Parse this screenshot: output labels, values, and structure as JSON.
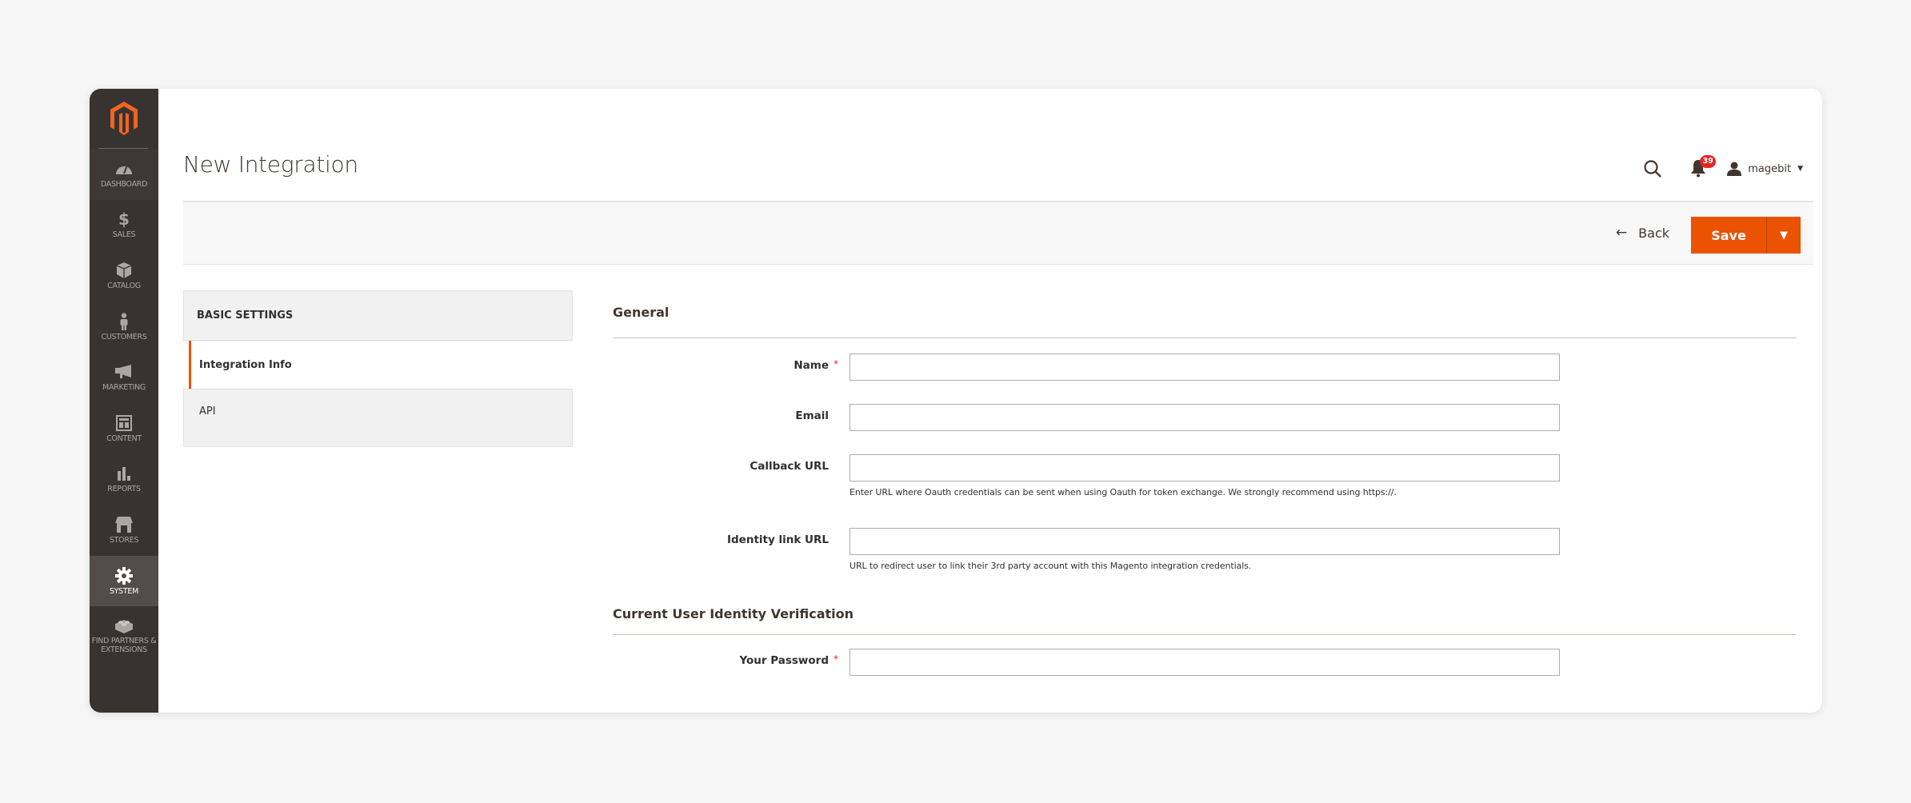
{
  "sidebar": {
    "logo": "magento-logo",
    "items": [
      {
        "label": "Dashboard",
        "icon": "dashboard-icon"
      },
      {
        "label": "Sales",
        "icon": "dollar-icon"
      },
      {
        "label": "Catalog",
        "icon": "box-icon"
      },
      {
        "label": "Customers",
        "icon": "person-icon"
      },
      {
        "label": "Marketing",
        "icon": "megaphone-icon"
      },
      {
        "label": "Content",
        "icon": "layout-icon"
      },
      {
        "label": "Reports",
        "icon": "bar-chart-icon"
      },
      {
        "label": "Stores",
        "icon": "storefront-icon"
      },
      {
        "label": "System",
        "icon": "gear-icon",
        "active": true
      },
      {
        "label": "Find Partners & Extensions",
        "icon": "lego-brick-icon"
      }
    ]
  },
  "header": {
    "title": "New Integration",
    "notifications_count": "39",
    "username": "magebit"
  },
  "toolbar": {
    "back_label": "Back",
    "save_label": "Save"
  },
  "tabs": {
    "heading": "Basic Settings",
    "items": [
      {
        "label": "Integration Info",
        "active": true
      },
      {
        "label": "API",
        "active": false
      }
    ]
  },
  "form": {
    "general_title": "General",
    "fields": {
      "name": {
        "label": "Name",
        "required": true,
        "value": ""
      },
      "email": {
        "label": "Email",
        "required": false,
        "value": ""
      },
      "callback_url": {
        "label": "Callback URL",
        "required": false,
        "value": "",
        "note": "Enter URL where Oauth credentials can be sent when using Oauth for token exchange. We strongly recommend using https://."
      },
      "identity_link_url": {
        "label": "Identity link URL",
        "required": false,
        "value": "",
        "note": "URL to redirect user to link their 3rd party account with this Magento integration credentials."
      }
    },
    "verification_title": "Current User Identity Verification",
    "password": {
      "label": "Your Password",
      "required": true,
      "value": ""
    },
    "required_marker": "*"
  },
  "colors": {
    "accent": "#eb5202",
    "sidebar_bg": "#373330",
    "badge": "#e22626"
  }
}
